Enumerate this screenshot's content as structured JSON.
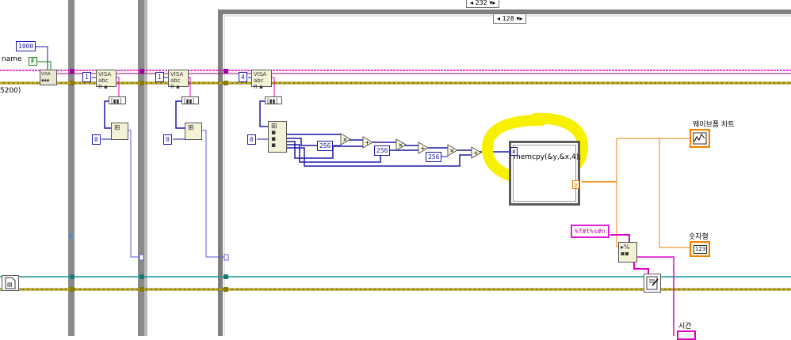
{
  "structures": {
    "outer_case_selector": "232",
    "inner_case_selector": "128"
  },
  "constants": {
    "timeout_value": "1000",
    "boolean_false": "F",
    "loop1_index": "1",
    "loop1_offset": "0",
    "loop2_index": "1",
    "loop2_offset": "0",
    "loop3_index": "4",
    "loop3_offset": "0",
    "multiplier_a": "256",
    "multiplier_b": "256",
    "multiplier_c": "256",
    "format_string": "%f#t%s#n"
  },
  "labels": {
    "left_name": "name",
    "left_baud": "5200)",
    "waveform_chart": "웨이브폼 차트",
    "numeric_indicator": "숫자형",
    "time_indicator": "시간"
  },
  "formula_node": {
    "code": "memcpy(&y,&x,4);",
    "input_tunnel": "x",
    "output_tunnel": "y"
  },
  "indicator_glyphs": {
    "numeric": "123"
  },
  "icons": [
    "visa-read-icon",
    "array-index-icon",
    "unbundle-icon",
    "multiply-icon",
    "add-icon",
    "waveform-chart-icon",
    "format-into-string-icon",
    "write-file-icon",
    "file-refnum-icon"
  ],
  "colors": {
    "highlight": "#f7f000",
    "wire_blue": "#2b2bd6",
    "wire_pink": "#e000c8",
    "wire_orange": "#f08000",
    "wire_teal": "#1a9a9a",
    "frame_gray": "#808080"
  }
}
